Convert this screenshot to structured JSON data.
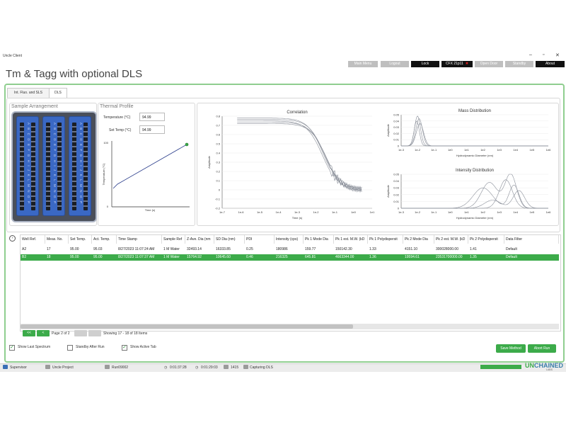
{
  "window": {
    "title": "Uncle Client"
  },
  "top_buttons": [
    {
      "label": "Main Menu",
      "style": "disabled"
    },
    {
      "label": "Logout",
      "style": "disabled"
    },
    {
      "label": "Lock",
      "style": "dark"
    },
    {
      "label": "CFX 21p11",
      "style": "dark"
    },
    {
      "label": "Open Door",
      "style": "disabled"
    },
    {
      "label": "Standby",
      "style": "disabled"
    },
    {
      "label": "About",
      "style": "dark"
    }
  ],
  "page_title": "Tm & Tagg with optional DLS",
  "tabs": [
    {
      "label": "Int. Fluo. and SLS"
    },
    {
      "label": "DLS"
    }
  ],
  "sample_arrangement": {
    "title": "Sample Arrangement",
    "strip_letters": [
      "A B C D E F G H I J K L M N O P",
      "A B C D E F G H I J K L M N O P",
      "A B C D E F G H I J K L M N O P"
    ]
  },
  "thermal": {
    "title": "Thermal Profile",
    "temperature_label": "Temperature (°C)",
    "temperature_value": "94.99",
    "set_temp_label": "Set Temp (°C)",
    "set_temp_value": "94.99",
    "ylabel": "Temperature (°C)",
    "xlabel": "Time (s)",
    "ymax_label": "100",
    "ymin_label": "0"
  },
  "charts": {
    "correlation": {
      "title": "Correlation",
      "xlabel": "Time (s)",
      "ylabel": "Amplitude",
      "yticks": [
        "0.8",
        "0.7",
        "0.6",
        "0.5",
        "0.4",
        "0.3",
        "0.2",
        "0.1",
        "0",
        "-0.1",
        "-0.2"
      ],
      "xticks": [
        "1e-7",
        "1e-6",
        "1e-5",
        "1e-4",
        "1e-3",
        "1e-2",
        "1e-1",
        "1e0",
        "1e1"
      ]
    },
    "mass": {
      "title": "Mass Distribution",
      "xlabel": "Hydrodynamic Diameter (nm)",
      "ylabel": "Amplitude",
      "yticks": [
        "0.05",
        "0.04",
        "0.03",
        "0.02",
        "0.01",
        "0"
      ],
      "xticks": [
        "1e-3",
        "1e-2",
        "1e-1",
        "1e0",
        "1e1",
        "1e2",
        "1e3",
        "1e4",
        "1e5",
        "1e6"
      ]
    },
    "intensity": {
      "title": "Intensity Distribution",
      "xlabel": "Hydrodynamic Diameter (nm)",
      "ylabel": "Amplitude",
      "yticks": [
        "0.05",
        "0.04",
        "0.03",
        "0.02",
        "0.01",
        "0"
      ],
      "xticks": [
        "1e-3",
        "1e-2",
        "1e-1",
        "1e0",
        "1e1",
        "1e2",
        "1e3",
        "1e4",
        "1e5",
        "1e6"
      ]
    }
  },
  "table": {
    "headers": [
      "Well Ref.",
      "Meas. No.",
      "Set Temp.",
      "Act. Temp.",
      "Time Stamp",
      "Sample Ref",
      "Z-Ave. Dia (nm",
      "SD Dia (nm)",
      "PDI",
      "Intensity (cps)",
      "Pk 1 Mode Dia",
      "Pk 1 est. M.W. (kD",
      "Pk 1 Polydispersit",
      "Pk 2 Mode Dia",
      "Pk 2 est. M.W. (kD",
      "Pk 2 Polydispersit",
      "Data Filter"
    ],
    "rows": [
      {
        "selected": false,
        "cells": [
          "A2",
          "17",
          "95.00",
          "95.03",
          "8/27/2023 11:07:24 AM",
          "1 M Water",
          "32493.14",
          "16333.85",
          "0.25",
          "180986",
          "159.77",
          "150142.30",
          "1.33",
          "4151.10",
          "300028000.00",
          "1.41",
          "Default"
        ]
      },
      {
        "selected": true,
        "cells": [
          "B2",
          "18",
          "95.00",
          "95.00",
          "8/27/2023 11:07:37 AM",
          "1 M Water",
          "15764.92",
          "10645.60",
          "0.46",
          "216325",
          "645.81",
          "4663344.00",
          "1.36",
          "19594.61",
          "23531700000.00",
          "1.35",
          "Default"
        ]
      }
    ]
  },
  "pagination": {
    "first": "<<",
    "prev": "<",
    "page_text": "Page 2 of 2",
    "next": ">",
    "last": ">>",
    "showing": "Showing 17 - 18 of 18 Items"
  },
  "options": [
    {
      "label": "Show Last Spectrum",
      "checked": true
    },
    {
      "label": "Standby After Run",
      "checked": false
    },
    {
      "label": "Show Active Tab",
      "checked": true
    }
  ],
  "actions": {
    "save_method": "Save Method",
    "abort_run": "Abort Run"
  },
  "status": {
    "user": "Supervisor",
    "project": "Uncle Project",
    "run": "Run09002",
    "elapsed": "0:01:37:28",
    "remaining": "0:01:29:03",
    "count": "1415",
    "state": "Capturing DLS"
  },
  "logo": {
    "text_a": "UN",
    "text_b": "CHAINED",
    "sub": "LABS"
  },
  "colors": {
    "accent_green": "#3cab4a",
    "frame_green": "#8fce8f",
    "plate_blue": "#3a68c4",
    "curve_gray": "#8a8f99"
  }
}
